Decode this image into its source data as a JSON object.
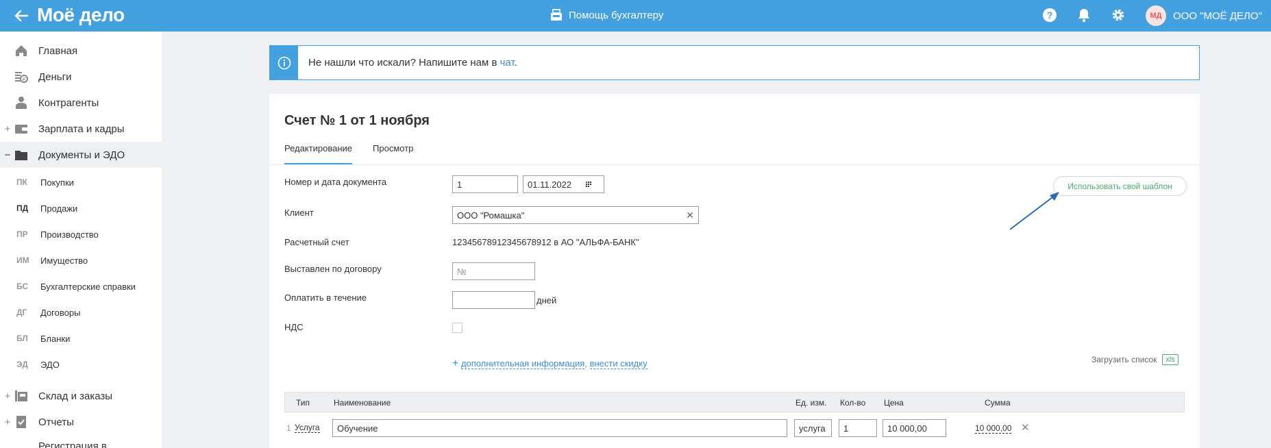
{
  "app": {
    "logo": "Моё дело",
    "help_center": "Помощь бухгалтеру",
    "org_initials": "МД",
    "org_name": "ООО \"МОЁ ДЕЛО\""
  },
  "colors": {
    "brand": "#43a1e0",
    "link": "#3b8fd4",
    "green": "#4aa96c"
  },
  "sidebar": {
    "items": [
      {
        "label": "Главная",
        "icon": "home-icon",
        "toggle": ""
      },
      {
        "label": "Деньги",
        "icon": "money-icon",
        "toggle": ""
      },
      {
        "label": "Контрагенты",
        "icon": "contractors-icon",
        "toggle": ""
      },
      {
        "label": "Зарплата и кадры",
        "icon": "salary-icon",
        "toggle": "+"
      },
      {
        "label": "Документы и ЭДО",
        "icon": "folder-icon",
        "toggle": "−"
      }
    ],
    "subitems": [
      {
        "abbr": "ПК",
        "label": "Покупки"
      },
      {
        "abbr": "ПД",
        "label": "Продажи"
      },
      {
        "abbr": "ПР",
        "label": "Производство"
      },
      {
        "abbr": "ИМ",
        "label": "Имущество"
      },
      {
        "abbr": "БС",
        "label": "Бухгалтерские справки"
      },
      {
        "abbr": "ДГ",
        "label": "Договоры"
      },
      {
        "abbr": "БЛ",
        "label": "Бланки"
      },
      {
        "abbr": "ЭД",
        "label": "ЭДО"
      }
    ],
    "bottom_items": [
      {
        "label": "Склад и заказы",
        "icon": "warehouse-icon",
        "toggle": "+"
      },
      {
        "label": "Отчеты",
        "icon": "reports-icon",
        "toggle": "+"
      },
      {
        "label": "Регистрация в",
        "icon": "",
        "toggle": ""
      }
    ]
  },
  "banner": {
    "text": "Не нашли что искали? Напишите нам в ",
    "link": "чат",
    "tail": "."
  },
  "document": {
    "title": "Счет № 1 от 1 ноября",
    "tabs": [
      "Редактирование",
      "Просмотр"
    ],
    "labels": {
      "number_date": "Номер и дата документа",
      "client": "Клиент",
      "account": "Расчетный счет",
      "contract": "Выставлен по договору",
      "pay_within": "Оплатить в течение",
      "vat": "НДС"
    },
    "values": {
      "number": "1",
      "date": "01.11.2022",
      "client": "ООО \"Ромашка\"",
      "account": "12345678912345678912 в АО \"АЛЬФА-БАНК\"",
      "contract_placeholder": "№",
      "pay_within": "",
      "days": "дней"
    },
    "extra_plus": "+",
    "extra_link1": "дополнительная информация",
    "extra_sep": ", ",
    "extra_link2": "внести скидку",
    "template_button": "Использовать свой шаблон",
    "load_list": "Загрузить список",
    "xls": "xls"
  },
  "table": {
    "headers": [
      "Тип",
      "Наименование",
      "Ед. изм.",
      "Кол-во",
      "Цена",
      "Сумма"
    ],
    "rows": [
      {
        "num": "1",
        "type": "Услуга",
        "name": "Обучение",
        "unit": "услуга",
        "qty": "1",
        "price": "10 000,00",
        "sum": "10 000,00"
      }
    ]
  }
}
